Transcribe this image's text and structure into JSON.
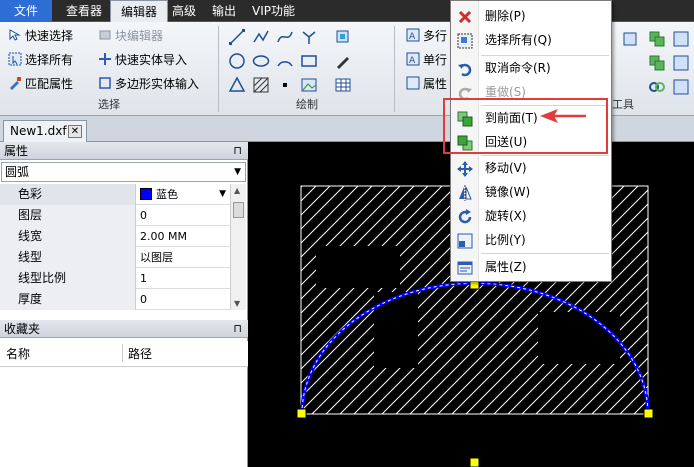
{
  "menubar": {
    "tabs": [
      "文件",
      "查看器",
      "编辑器",
      "高级",
      "输出",
      "VIP功能"
    ],
    "active_tab": "编辑器"
  },
  "ribbon": {
    "select_group": {
      "label": "选择",
      "quick_select": "快速选择",
      "select_all": "选择所有",
      "match_props": "匹配属性",
      "block_editor": "块编辑器",
      "quick_entity_import": "快速实体导入",
      "polygon_entity_input": "多边形实体输入"
    },
    "draw_group": {
      "label": "绘制"
    },
    "text_group": {
      "multiline": "多行",
      "singleline": "单行",
      "props": "属性"
    },
    "tools_group": {
      "label": "工具"
    }
  },
  "doc_tab": {
    "name": "New1.dxf",
    "close": "✕"
  },
  "properties_panel": {
    "title": "属性",
    "pin": "⊓",
    "object_type": "圆弧",
    "rows": [
      {
        "name": "色彩",
        "value": "蓝色"
      },
      {
        "name": "图层",
        "value": "0"
      },
      {
        "name": "线宽",
        "value": "2.00 MM"
      },
      {
        "name": "线型",
        "value": "以图层"
      },
      {
        "name": "线型比例",
        "value": "1"
      },
      {
        "name": "厚度",
        "value": "0"
      }
    ]
  },
  "favorites_panel": {
    "title": "收藏夹",
    "pin": "⊓",
    "col_name": "名称",
    "col_path": "路径"
  },
  "context_menu": {
    "items": [
      {
        "label": "删除(P)",
        "icon": "delete-icon"
      },
      {
        "label": "选择所有(Q)",
        "icon": "select-all-icon"
      },
      {
        "label": "取消命令(R)",
        "icon": "undo-icon"
      },
      {
        "label": "重做(S)",
        "icon": "redo-icon",
        "disabled": true
      },
      {
        "label": "到前面(T)",
        "icon": "bring-front-icon"
      },
      {
        "label": "回送(U)",
        "icon": "send-back-icon"
      },
      {
        "label": "移动(V)",
        "icon": "move-icon"
      },
      {
        "label": "镜像(W)",
        "icon": "mirror-icon"
      },
      {
        "label": "旋转(X)",
        "icon": "rotate-icon"
      },
      {
        "label": "比例(Y)",
        "icon": "scale-icon"
      },
      {
        "label": "属性(Z)",
        "icon": "properties-icon"
      }
    ]
  },
  "colors": {
    "arc": "#0000ff",
    "highlight": "#e23b3b",
    "canvas_bg": "#000000",
    "grip": "#ffff00"
  }
}
